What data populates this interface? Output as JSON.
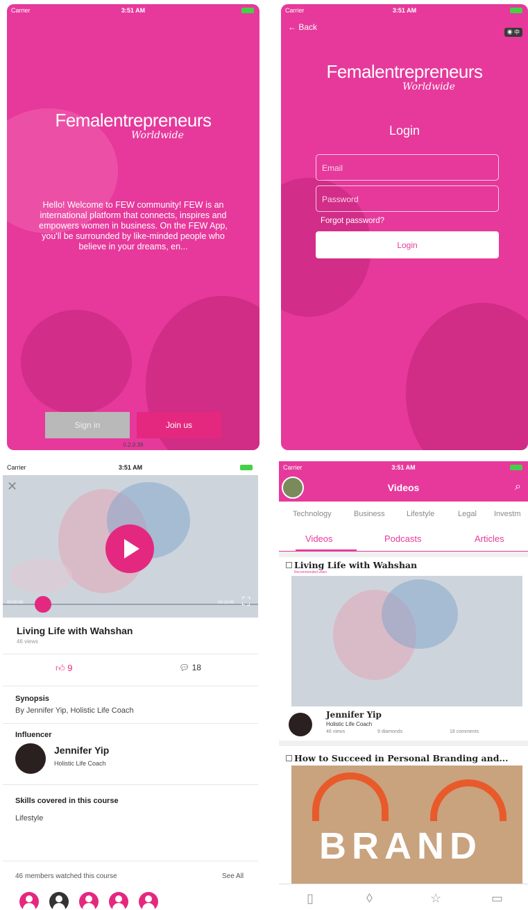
{
  "status": {
    "carrier": "Carrier",
    "time": "3:51 AM"
  },
  "logo": {
    "line1": "Femalentrepreneurs",
    "line2": "Worldwide"
  },
  "welcome": {
    "text": "Hello! Welcome to FEW community! FEW is an international platform that connects, inspires and empowers women in business. On the FEW App, you'll be surrounded by like-minded people who believe in your dreams, en...",
    "sign_in": "Sign in",
    "join_us": "Join us",
    "version": "0.2.0.39"
  },
  "login": {
    "back": "Back",
    "lang": "中",
    "title": "Login",
    "email_placeholder": "Email",
    "password_placeholder": "Password",
    "forgot": "Forgot password?",
    "login_button": "Login"
  },
  "course": {
    "time_start": "00:00:00",
    "time_end": "00:13:05",
    "title": "Living Life with Wahshan",
    "views": "46 views",
    "likes": "9",
    "comments": "18",
    "synopsis_label": "Synopsis",
    "synopsis": "By Jennifer Yip, Holistic Life Coach",
    "influencer_label": "Influencer",
    "influencer_name": "Jennifer Yip",
    "influencer_role": "Holistic Life Coach",
    "skills_label": "Skills covered in this course",
    "skill": "Lifestyle",
    "members": "46 members watched this course",
    "see_all": "See All"
  },
  "videos": {
    "header": "Videos",
    "categories": [
      "Technology",
      "Business",
      "Lifestyle",
      "Legal",
      "Investm"
    ],
    "tabs": [
      "Videos",
      "Podcasts",
      "Articles"
    ],
    "card1": {
      "title": "Living Life with Wahshan",
      "tag": "Recommended video",
      "author": "Jennifer Yip",
      "role": "Holistic Life Coach",
      "views": "46 views",
      "diamonds": "9 diamonds",
      "comments": "18 comments"
    },
    "card2": {
      "title": "How to Succeed in Personal Branding and...",
      "image_word": "BRAND"
    }
  },
  "colors": {
    "brand_pink": "#e6399b",
    "play_pink": "#e4287f"
  }
}
